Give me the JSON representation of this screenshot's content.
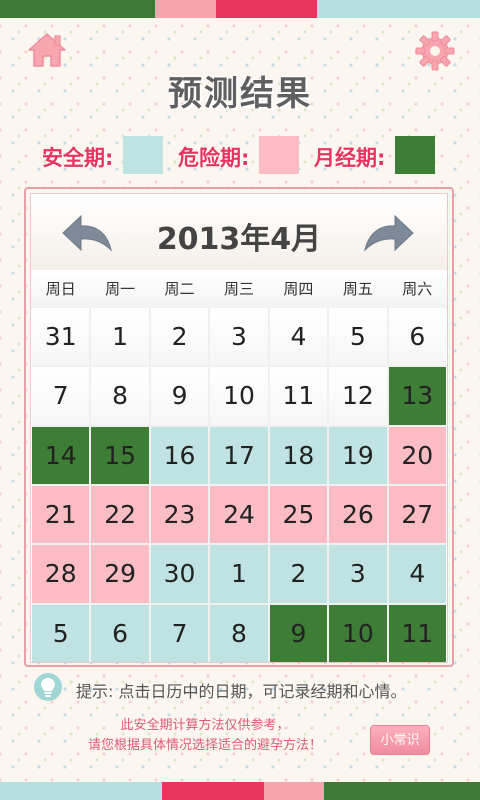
{
  "colors": {
    "safe": "#bfe3e3",
    "danger": "#fbbcc3",
    "period": "#3e7d35",
    "accent": "#e8345f"
  },
  "stripes": {
    "top": [
      "#3d7a38",
      "#f9a3ad",
      "#e8345f",
      "#b5dfe0"
    ],
    "bottom": [
      "#b5dfe0",
      "#e8345f",
      "#f9a3ad",
      "#3d7a38"
    ]
  },
  "header": {
    "title": "预测结果",
    "home_icon": "home-icon",
    "settings_icon": "gear-icon"
  },
  "legend": {
    "safe_label": "安全期:",
    "danger_label": "危险期:",
    "period_label": "月经期:"
  },
  "calendar": {
    "month_title": "2013年4月",
    "prev_icon": "arrow-left-icon",
    "next_icon": "arrow-right-icon",
    "weekdays": [
      "周日",
      "周一",
      "周二",
      "周三",
      "周四",
      "周五",
      "周六"
    ],
    "days": [
      {
        "d": "31",
        "t": "normal"
      },
      {
        "d": "1",
        "t": "normal"
      },
      {
        "d": "2",
        "t": "normal"
      },
      {
        "d": "3",
        "t": "normal"
      },
      {
        "d": "4",
        "t": "normal"
      },
      {
        "d": "5",
        "t": "normal"
      },
      {
        "d": "6",
        "t": "normal"
      },
      {
        "d": "7",
        "t": "normal"
      },
      {
        "d": "8",
        "t": "normal"
      },
      {
        "d": "9",
        "t": "normal"
      },
      {
        "d": "10",
        "t": "normal"
      },
      {
        "d": "11",
        "t": "normal"
      },
      {
        "d": "12",
        "t": "normal"
      },
      {
        "d": "13",
        "t": "period"
      },
      {
        "d": "14",
        "t": "period"
      },
      {
        "d": "15",
        "t": "period"
      },
      {
        "d": "16",
        "t": "safe"
      },
      {
        "d": "17",
        "t": "safe"
      },
      {
        "d": "18",
        "t": "safe"
      },
      {
        "d": "19",
        "t": "safe"
      },
      {
        "d": "20",
        "t": "danger"
      },
      {
        "d": "21",
        "t": "danger"
      },
      {
        "d": "22",
        "t": "danger"
      },
      {
        "d": "23",
        "t": "danger"
      },
      {
        "d": "24",
        "t": "danger"
      },
      {
        "d": "25",
        "t": "danger"
      },
      {
        "d": "26",
        "t": "danger"
      },
      {
        "d": "27",
        "t": "danger"
      },
      {
        "d": "28",
        "t": "danger"
      },
      {
        "d": "29",
        "t": "danger"
      },
      {
        "d": "30",
        "t": "safe"
      },
      {
        "d": "1",
        "t": "safe"
      },
      {
        "d": "2",
        "t": "safe"
      },
      {
        "d": "3",
        "t": "safe"
      },
      {
        "d": "4",
        "t": "safe"
      },
      {
        "d": "5",
        "t": "safe"
      },
      {
        "d": "6",
        "t": "safe"
      },
      {
        "d": "7",
        "t": "safe"
      },
      {
        "d": "8",
        "t": "safe"
      },
      {
        "d": "9",
        "t": "period"
      },
      {
        "d": "10",
        "t": "period"
      },
      {
        "d": "11",
        "t": "period"
      }
    ]
  },
  "footer": {
    "tip_icon": "lightbulb-icon",
    "tip_text": "提示: 点击日历中的日期，可记录经期和心情。",
    "disclaimer_line1": "此安全期计算方法仅供参考，",
    "disclaimer_line2": "请您根据具体情况选择适合的避孕方法！",
    "tips_button": "小常识"
  }
}
